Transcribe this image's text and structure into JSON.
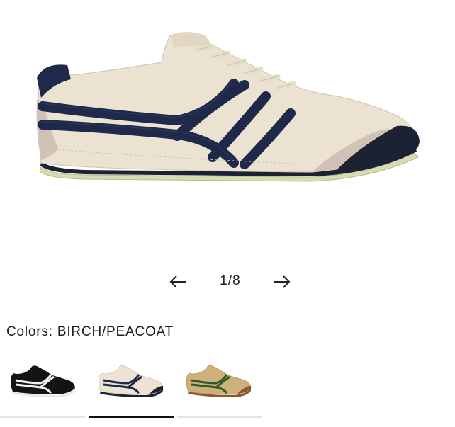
{
  "product": {
    "image_icon": "sneaker-birch-peacoat-side-view",
    "colors": {
      "upper": "#ebe2d1",
      "stripes": "#1f2a4a",
      "sole": "#d7dbb0",
      "toe_cap": "#1c2233",
      "heel_suede": "#d0c2b6"
    }
  },
  "gallery": {
    "prev_icon": "arrow-left-icon",
    "next_icon": "arrow-right-icon",
    "counter": "1/8"
  },
  "color_selector": {
    "label": "Colors: BIRCH/PEACOAT",
    "selected_index": 1,
    "options": [
      {
        "icon": "sneaker-black-white-thumbnail"
      },
      {
        "icon": "sneaker-birch-peacoat-thumbnail"
      },
      {
        "icon": "sneaker-tan-green-thumbnail"
      }
    ]
  }
}
